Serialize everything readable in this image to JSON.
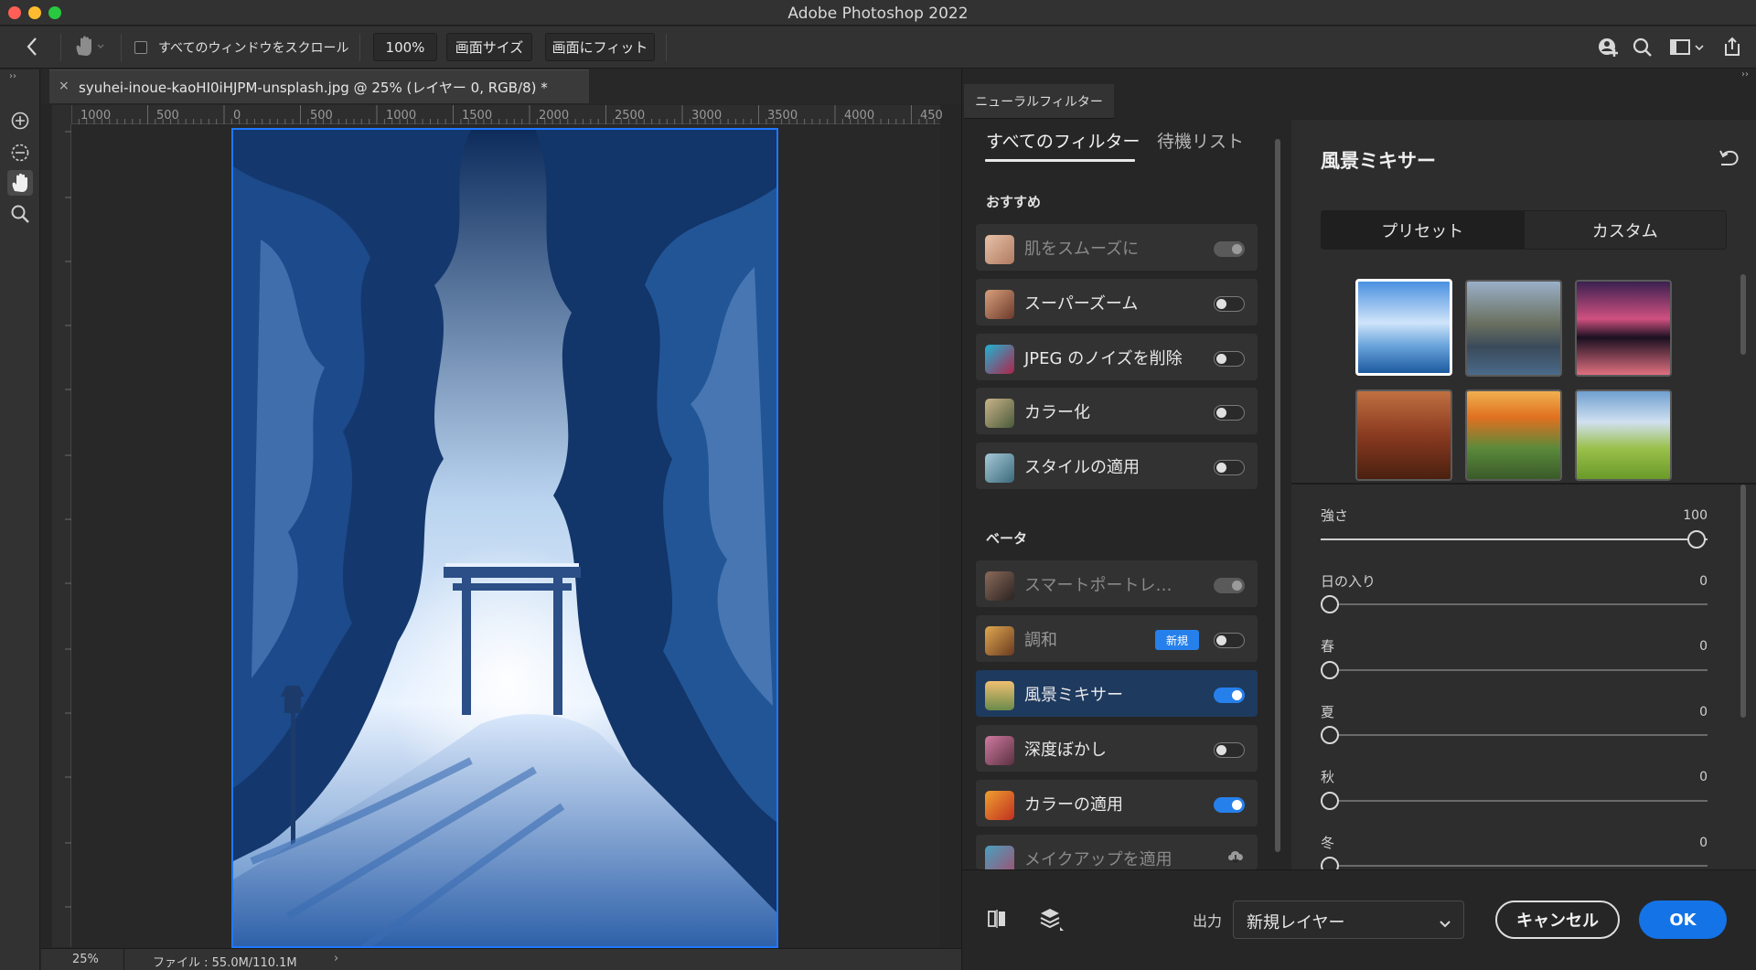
{
  "window": {
    "title": "Adobe Photoshop 2022"
  },
  "options_bar": {
    "scroll_all_label": "すべてのウィンドウをスクロール",
    "zoom_button": "100%",
    "screen_size_button": "画面サイズ",
    "fit_screen_button": "画面にフィット"
  },
  "document": {
    "tab_title": "syuhei-inoue-kaoHI0iHJPM-unsplash.jpg @ 25% (レイヤー 0, RGB/8) *",
    "ruler_ticks": [
      "1000",
      "500",
      "0",
      "500",
      "1000",
      "1500",
      "2000",
      "2500",
      "3000",
      "3500",
      "4000",
      "450"
    ],
    "zoom": "25%",
    "file_info": "ファイル : 55.0M/110.1M"
  },
  "neural_filters": {
    "panel_tab": "ニューラルフィルター",
    "list_tabs": {
      "all": "すべてのフィルター",
      "waitlist": "待機リスト"
    },
    "featured_label": "おすすめ",
    "beta_label": "ベータ",
    "featured": [
      {
        "label": "肌をスムーズに",
        "state": "dim"
      },
      {
        "label": "スーパーズーム",
        "state": "off"
      },
      {
        "label": "JPEG のノイズを削除",
        "state": "off"
      },
      {
        "label": "カラー化",
        "state": "off"
      },
      {
        "label": "スタイルの適用",
        "state": "off"
      }
    ],
    "beta": [
      {
        "label": "スマートポートレ…",
        "state": "dim"
      },
      {
        "label": "調和",
        "state": "off",
        "badge": "新規"
      },
      {
        "label": "風景ミキサー",
        "state": "on"
      },
      {
        "label": "深度ぼかし",
        "state": "off"
      },
      {
        "label": "カラーの適用",
        "state": "on"
      },
      {
        "label": "メイクアップを適用",
        "state": "cloud"
      }
    ],
    "settings": {
      "title": "風景ミキサー",
      "segments": {
        "preset": "プリセット",
        "custom": "カスタム"
      },
      "sliders": [
        {
          "label": "強さ",
          "value": "100",
          "level": 1.0
        },
        {
          "label": "日の入り",
          "value": "0",
          "level": 0
        },
        {
          "label": "春",
          "value": "0",
          "level": 0
        },
        {
          "label": "夏",
          "value": "0",
          "level": 0
        },
        {
          "label": "秋",
          "value": "0",
          "level": 0
        },
        {
          "label": "冬",
          "value": "0",
          "level": 0
        }
      ]
    },
    "footer": {
      "output_label": "出力",
      "output_value": "新規レイヤー",
      "cancel": "キャンセル",
      "ok": "OK"
    }
  },
  "colors": {
    "accent": "#2680eb",
    "selection": "#1f78ff",
    "active_item": "#1e3a5f"
  }
}
